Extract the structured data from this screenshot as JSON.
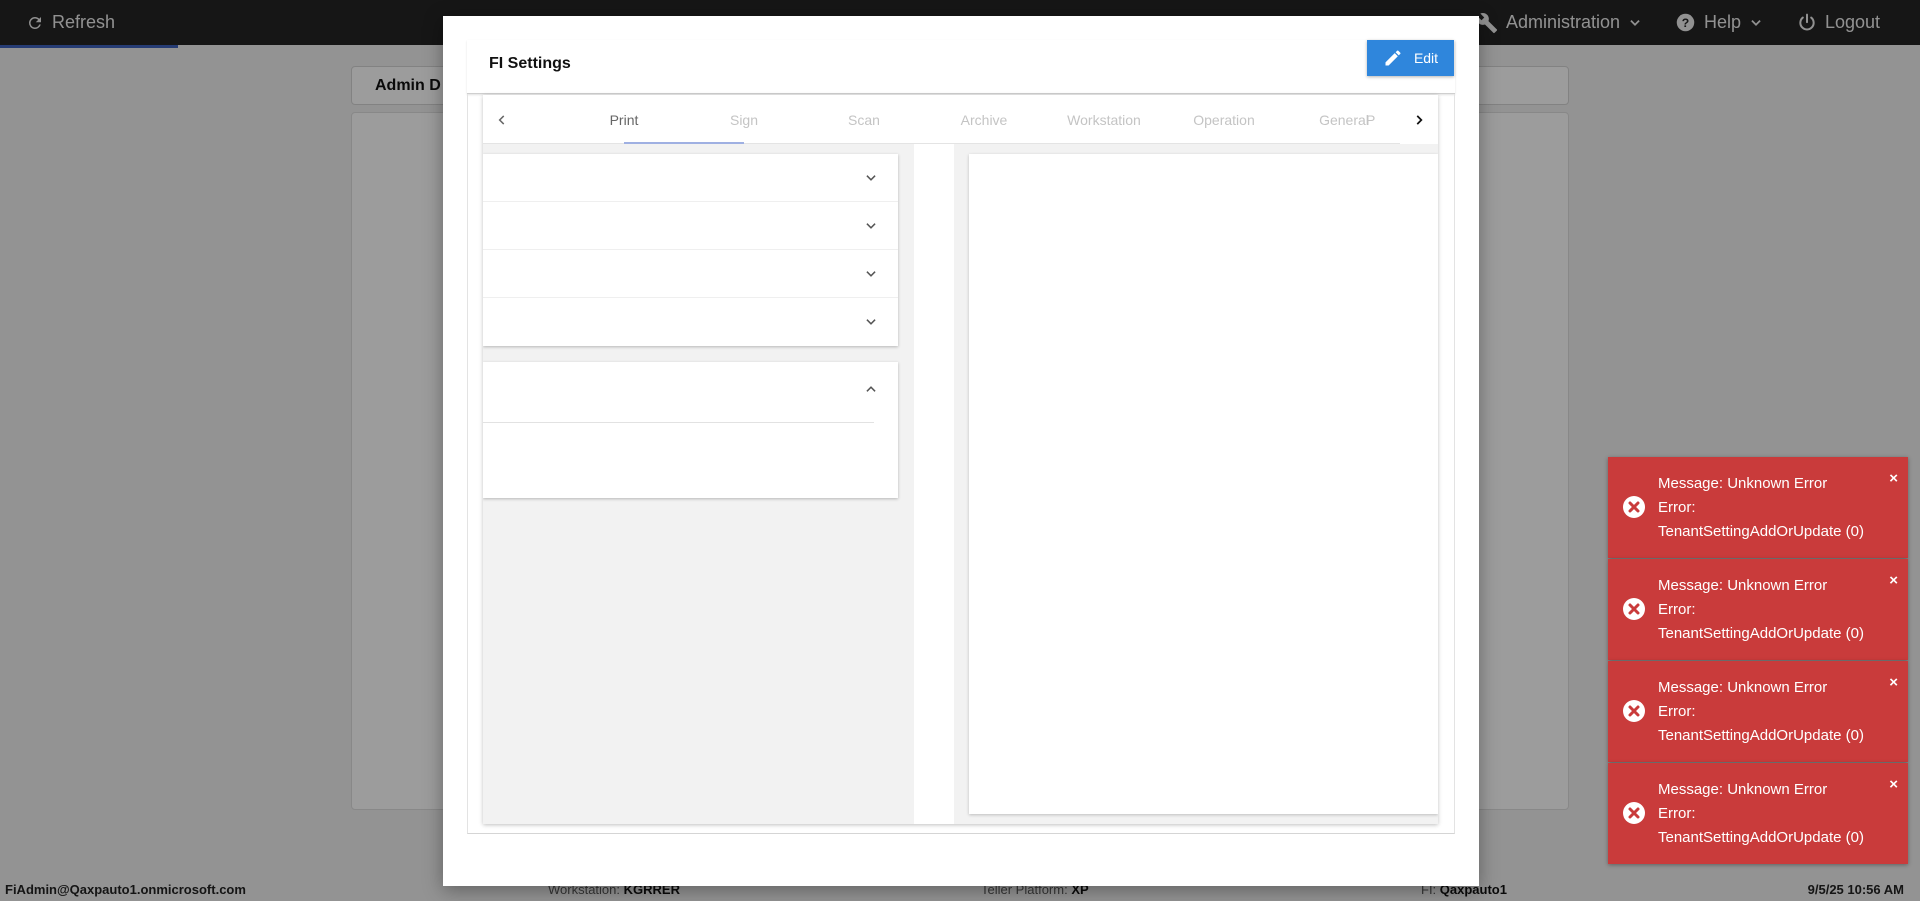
{
  "topbar": {
    "refresh_label": "Refresh",
    "administration_label": "Administration",
    "help_label": "Help",
    "logout_label": "Logout"
  },
  "background": {
    "header_title": "Admin D"
  },
  "statusbar": {
    "user": "FiAdmin@Qaxpauto1.onmicrosoft.com",
    "workstation_label": "Workstation:",
    "workstation_value": "KGRRER",
    "teller_platform_label": "Teller Platform:",
    "teller_platform_value": "XP",
    "fi_label": "FI:",
    "fi_value": "Qaxpauto1",
    "datetime": "9/5/25 10:56 AM"
  },
  "modal": {
    "title": "FI Settings",
    "edit_label": "Edit",
    "tabs": [
      {
        "label": "Print",
        "active": true
      },
      {
        "label": "Sign",
        "active": false
      },
      {
        "label": "Scan",
        "active": false
      },
      {
        "label": "Archive",
        "active": false
      },
      {
        "label": "Workstation",
        "active": false
      },
      {
        "label": "Operation",
        "active": false
      },
      {
        "label": "General",
        "active": false
      },
      {
        "label": "P",
        "active": false
      }
    ]
  },
  "toasts": [
    {
      "message": "Message: Unknown Error",
      "error_label": "Error:",
      "error_detail": "TenantSettingAddOrUpdate (0)",
      "close": "×"
    },
    {
      "message": "Message: Unknown Error",
      "error_label": "Error:",
      "error_detail": "TenantSettingAddOrUpdate (0)",
      "close": "×"
    },
    {
      "message": "Message: Unknown Error",
      "error_label": "Error:",
      "error_detail": "TenantSettingAddOrUpdate (0)",
      "close": "×"
    },
    {
      "message": "Message: Unknown Error",
      "error_label": "Error:",
      "error_detail": "TenantSettingAddOrUpdate (0)",
      "close": "×"
    }
  ],
  "colors": {
    "topbar_bg": "#232323",
    "accent_blue": "#2f86dc",
    "toast_red": "#c93b3b",
    "tab_indicator": "#9fb0e2"
  }
}
